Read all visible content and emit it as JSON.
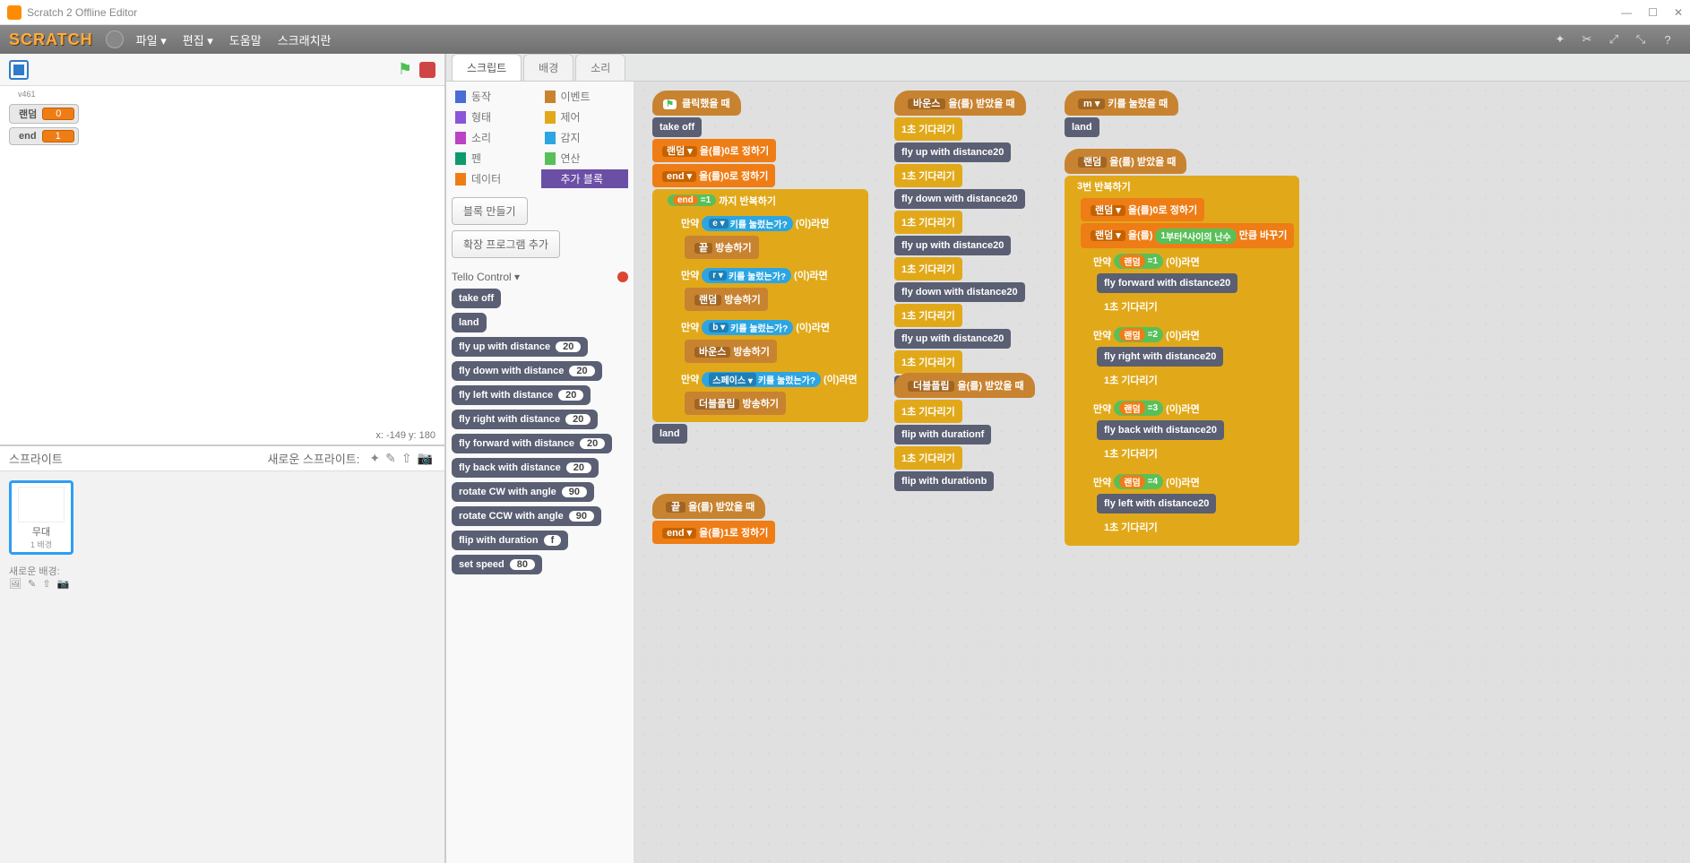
{
  "window": {
    "title": "Scratch 2 Offline Editor"
  },
  "menubar": {
    "logo": "SCRATCH",
    "file": "파일 ▾",
    "edit": "편집 ▾",
    "help": "도움말",
    "about": "스크래치란"
  },
  "stage": {
    "vlabel": "v461",
    "coords": "x: -149 y: 180",
    "monitors": [
      {
        "name": "랜덤",
        "value": "0"
      },
      {
        "name": "end",
        "value": "1"
      }
    ]
  },
  "sprites": {
    "header": "스프라이트",
    "new_label": "새로운 스프라이트:",
    "thumb": {
      "name": "무대",
      "sub": "1 배경"
    },
    "new_backdrop": "새로운 배경:"
  },
  "tabs": {
    "scripts": "스크립트",
    "costumes": "배경",
    "sounds": "소리"
  },
  "categories": {
    "motion": "동작",
    "events": "이벤트",
    "looks": "형태",
    "control": "제어",
    "sound": "소리",
    "sensing": "감지",
    "pen": "펜",
    "operators": "연산",
    "data": "데이터",
    "more": "추가 블록"
  },
  "palette": {
    "make_block": "블록 만들기",
    "add_ext": "확장 프로그램 추가",
    "section": "Tello Control ▾",
    "blocks": [
      {
        "label": "take off"
      },
      {
        "label": "land"
      },
      {
        "label": "fly up with distance",
        "arg": "20"
      },
      {
        "label": "fly down with distance",
        "arg": "20"
      },
      {
        "label": "fly left with distance",
        "arg": "20"
      },
      {
        "label": "fly right with distance",
        "arg": "20"
      },
      {
        "label": "fly forward with distance",
        "arg": "20"
      },
      {
        "label": "fly back with distance",
        "arg": "20"
      },
      {
        "label": "rotate CW with angle",
        "arg": "90"
      },
      {
        "label": "rotate CCW with angle",
        "arg": "90"
      },
      {
        "label": "flip with duration",
        "arg": "f"
      },
      {
        "label": "set speed",
        "arg": "80"
      }
    ]
  },
  "text": {
    "when_clicked": "클릭했을 때",
    "set_to": "을(를)",
    "set_suffix": "로 정하기",
    "until": "까지 반복하기",
    "if": "만약",
    "then": "(이)라면",
    "key_pressed": "키를 눌렀는가?",
    "broadcast": "방송하기",
    "when_receive": "을(를) 받았을 때",
    "wait_prefix": "",
    "wait_suffix": "초 기다리기",
    "when_key": "키를 눌렀을 때",
    "repeat": "번 반복하기",
    "random_from": "부터",
    "random_to": "사이의 난수",
    "change_by": "만큼 바꾸기",
    "msgs": {
      "end_msg": "끝",
      "random_msg": "랜덤",
      "bounce": "바운스",
      "doubleflip": "더블플립",
      "space": "스페이스 ▾",
      "e": "e ▾",
      "r": "r ▾",
      "b": "b ▾",
      "m": "m ▾"
    },
    "vars": {
      "random": "랜덤 ▾",
      "end": "end ▾",
      "random_plain": "랜덤",
      "end_plain": "end"
    },
    "take_off": "take off",
    "land": "land",
    "fly_up": "fly up with distance",
    "fly_down": "fly down with distance",
    "fly_fwd": "fly forward with distance",
    "fly_back": "fly back with distance",
    "fly_left": "fly left with distance",
    "fly_right": "fly right with distance",
    "flip": "flip with duration"
  }
}
